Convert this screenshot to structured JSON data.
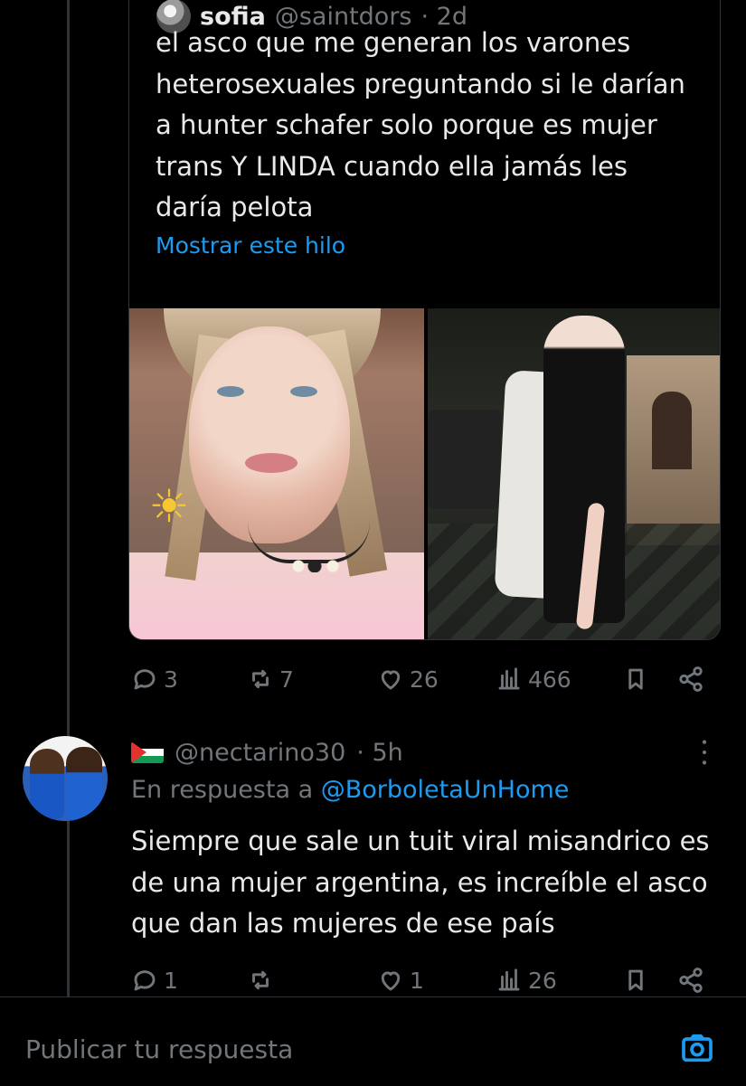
{
  "quoted_tweet": {
    "name": "sofia",
    "handle": "@saintdors",
    "time": "· 2d",
    "text": "el asco que me generan los varones heterosexuales preguntando si le darían a hunter schafer solo porque es mujer trans Y LINDA cuando ella jamás les daría pelota",
    "show_thread": "Mostrar este hilo",
    "actions": {
      "reply_count": "3",
      "repost_count": "7",
      "like_count": "26",
      "views_count": "466"
    }
  },
  "reply_tweet": {
    "handle": "@nectarino30",
    "time": "· 5h",
    "reply_to_label": "En respuesta a ",
    "reply_to_handle": "@BorboletaUnHome",
    "text": "Siempre que sale un tuit viral misandrico es de una mujer argentina, es increíble el asco que dan las mujeres de ese país",
    "actions": {
      "reply_count": "1",
      "repost_count": "",
      "like_count": "1",
      "views_count": "26"
    }
  },
  "composer": {
    "placeholder": "Publicar tu respuesta"
  },
  "icons": {
    "reply": "reply-icon",
    "repost": "repost-icon",
    "like": "heart-icon",
    "views": "views-icon",
    "bookmark": "bookmark-icon",
    "share": "share-icon",
    "more": "more-icon",
    "camera": "camera-icon"
  },
  "colors": {
    "background": "#000000",
    "text": "#e7e9ea",
    "muted": "#71767b",
    "link": "#1d9bf0",
    "border": "#2f3336"
  }
}
